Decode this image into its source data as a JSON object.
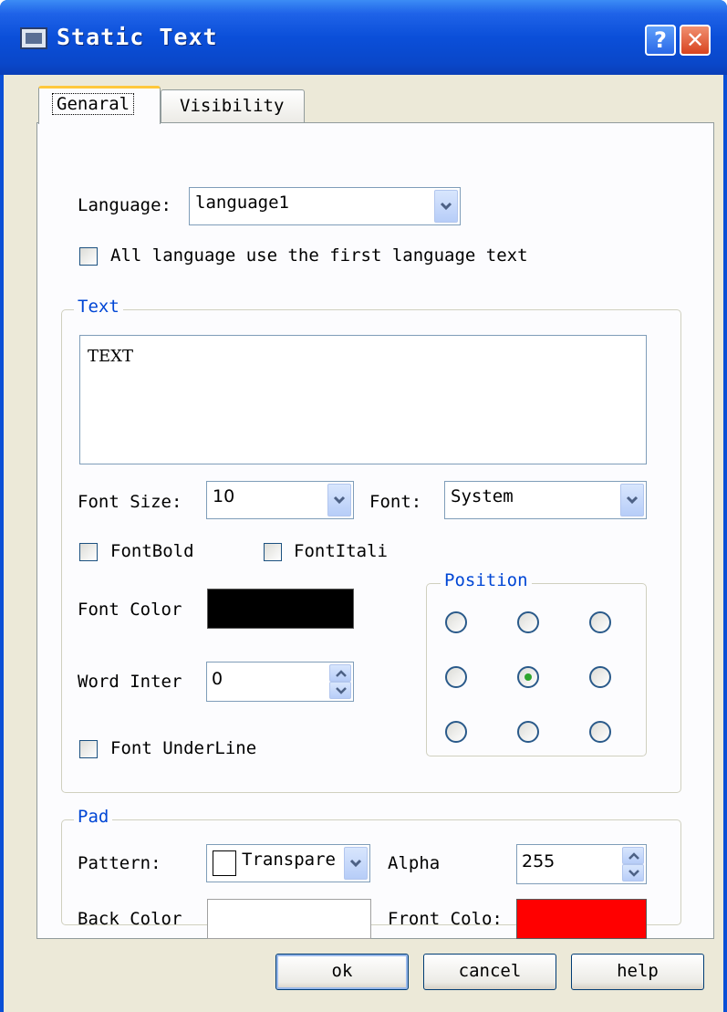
{
  "window": {
    "title": "Static Text",
    "help_glyph": "?",
    "close_glyph": "✕"
  },
  "tabs": [
    {
      "label": "Genaral",
      "active": true
    },
    {
      "label": "Visibility",
      "active": false
    }
  ],
  "general": {
    "language_label": "Language:",
    "language_value": "language1",
    "all_language_label": "All language use the first language text",
    "all_language_checked": false,
    "text_group": {
      "legend": "Text",
      "content": "TEXT",
      "font_size_label": "Font Size:",
      "font_size_value": "10",
      "font_label": "Font:",
      "font_value": "System",
      "font_bold_label": "FontBold",
      "font_bold_checked": false,
      "font_italic_label": "FontItali",
      "font_italic_checked": false,
      "font_color_label": "Font Color",
      "font_color": "#000000",
      "word_inter_label": "Word Inter",
      "word_inter_value": "0",
      "underline_label": "Font UnderLine",
      "underline_checked": false,
      "position": {
        "legend": "Position",
        "selected_row": 2,
        "selected_col": 2
      }
    },
    "pad_group": {
      "legend": "Pad",
      "pattern_label": "Pattern:",
      "pattern_value": "Transpare",
      "alpha_label": "Alpha",
      "alpha_value": "255",
      "back_color_label": "Back Color",
      "back_color": "#ffffff",
      "front_color_label": "Front Colo:",
      "front_color": "#ff0000"
    }
  },
  "buttons": {
    "ok": "ok",
    "cancel": "cancel",
    "help": "help"
  }
}
